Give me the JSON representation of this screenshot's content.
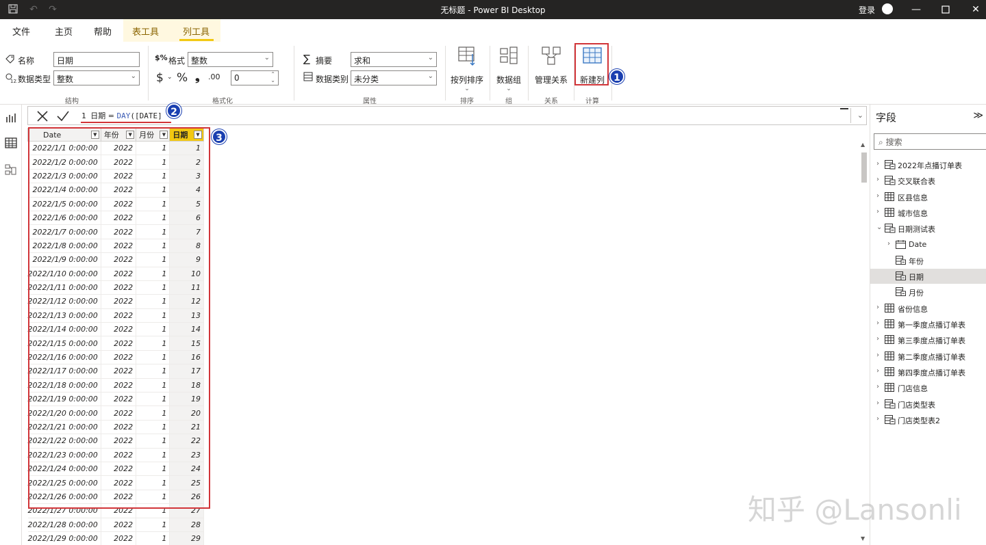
{
  "window": {
    "title": "无标题 - Power BI Desktop",
    "login": "登录"
  },
  "menu": {
    "tabs": [
      "文件",
      "主页",
      "帮助",
      "表工具",
      "列工具"
    ]
  },
  "ribbon": {
    "name_label": "名称",
    "name_value": "日期",
    "datatype_label": "数据类型",
    "datatype_value": "整数",
    "format_label": "格式",
    "format_value": "整数",
    "currency_symbol": "$",
    "percent_symbol": "%",
    "comma_symbol": "❟",
    "decimal_symbol": ".00",
    "decimals_value": "0",
    "summary_label": "摘要",
    "summary_value": "求和",
    "category_label": "数据类别",
    "category_value": "未分类",
    "sort_button": "按列排序",
    "datagroup_button": "数据组",
    "relations_button": "管理关系",
    "newcolumn_button": "新建列",
    "groups": [
      "结构",
      "格式化",
      "属性",
      "排序",
      "组",
      "关系",
      "计算"
    ]
  },
  "badges": [
    "1",
    "2",
    "3"
  ],
  "formula": {
    "line_number": "1",
    "text_prefix": "日期 = ",
    "function": "DAY",
    "argument": "([DATE]"
  },
  "table": {
    "columns": [
      "Date",
      "年份",
      "月份",
      "日期"
    ],
    "rows": [
      [
        "2022/1/1 0:00:00",
        "2022",
        "1",
        "1"
      ],
      [
        "2022/1/2 0:00:00",
        "2022",
        "1",
        "2"
      ],
      [
        "2022/1/3 0:00:00",
        "2022",
        "1",
        "3"
      ],
      [
        "2022/1/4 0:00:00",
        "2022",
        "1",
        "4"
      ],
      [
        "2022/1/5 0:00:00",
        "2022",
        "1",
        "5"
      ],
      [
        "2022/1/6 0:00:00",
        "2022",
        "1",
        "6"
      ],
      [
        "2022/1/7 0:00:00",
        "2022",
        "1",
        "7"
      ],
      [
        "2022/1/8 0:00:00",
        "2022",
        "1",
        "8"
      ],
      [
        "2022/1/9 0:00:00",
        "2022",
        "1",
        "9"
      ],
      [
        "2022/1/10 0:00:00",
        "2022",
        "1",
        "10"
      ],
      [
        "2022/1/11 0:00:00",
        "2022",
        "1",
        "11"
      ],
      [
        "2022/1/12 0:00:00",
        "2022",
        "1",
        "12"
      ],
      [
        "2022/1/13 0:00:00",
        "2022",
        "1",
        "13"
      ],
      [
        "2022/1/14 0:00:00",
        "2022",
        "1",
        "14"
      ],
      [
        "2022/1/15 0:00:00",
        "2022",
        "1",
        "15"
      ],
      [
        "2022/1/16 0:00:00",
        "2022",
        "1",
        "16"
      ],
      [
        "2022/1/17 0:00:00",
        "2022",
        "1",
        "17"
      ],
      [
        "2022/1/18 0:00:00",
        "2022",
        "1",
        "18"
      ],
      [
        "2022/1/19 0:00:00",
        "2022",
        "1",
        "19"
      ],
      [
        "2022/1/20 0:00:00",
        "2022",
        "1",
        "20"
      ],
      [
        "2022/1/21 0:00:00",
        "2022",
        "1",
        "21"
      ],
      [
        "2022/1/22 0:00:00",
        "2022",
        "1",
        "22"
      ],
      [
        "2022/1/23 0:00:00",
        "2022",
        "1",
        "23"
      ],
      [
        "2022/1/24 0:00:00",
        "2022",
        "1",
        "24"
      ],
      [
        "2022/1/25 0:00:00",
        "2022",
        "1",
        "25"
      ],
      [
        "2022/1/26 0:00:00",
        "2022",
        "1",
        "26"
      ],
      [
        "2022/1/27 0:00:00",
        "2022",
        "1",
        "27"
      ],
      [
        "2022/1/28 0:00:00",
        "2022",
        "1",
        "28"
      ],
      [
        "2022/1/29 0:00:00",
        "2022",
        "1",
        "29"
      ]
    ]
  },
  "fields": {
    "title": "字段",
    "search_placeholder": "搜索",
    "items": [
      {
        "label": "2022年点播订单表",
        "level": 0,
        "icon": "table-calc-icon",
        "chevron": "›"
      },
      {
        "label": "交叉联合表",
        "level": 0,
        "icon": "table-calc-icon",
        "chevron": "›"
      },
      {
        "label": "区县信息",
        "level": 0,
        "icon": "table-icon",
        "chevron": "›"
      },
      {
        "label": "城市信息",
        "level": 0,
        "icon": "table-icon",
        "chevron": "›"
      },
      {
        "label": "日期测试表",
        "level": 0,
        "icon": "table-calc-icon",
        "chevron": "⌄"
      },
      {
        "label": "Date",
        "level": 1,
        "icon": "calendar-icon",
        "chevron": "›"
      },
      {
        "label": "年份",
        "level": 1,
        "icon": "calc-column-icon",
        "chevron": ""
      },
      {
        "label": "日期",
        "level": 1,
        "icon": "calc-column-icon",
        "chevron": "",
        "selected": true
      },
      {
        "label": "月份",
        "level": 1,
        "icon": "calc-column-icon",
        "chevron": ""
      },
      {
        "label": "省份信息",
        "level": 0,
        "icon": "table-icon",
        "chevron": "›"
      },
      {
        "label": "第一季度点播订单表",
        "level": 0,
        "icon": "table-icon",
        "chevron": "›"
      },
      {
        "label": "第三季度点播订单表",
        "level": 0,
        "icon": "table-icon",
        "chevron": "›"
      },
      {
        "label": "第二季度点播订单表",
        "level": 0,
        "icon": "table-icon",
        "chevron": "›"
      },
      {
        "label": "第四季度点播订单表",
        "level": 0,
        "icon": "table-icon",
        "chevron": "›"
      },
      {
        "label": "门店信息",
        "level": 0,
        "icon": "table-icon",
        "chevron": "›"
      },
      {
        "label": "门店类型表",
        "level": 0,
        "icon": "table-calc-icon",
        "chevron": "›"
      },
      {
        "label": "门店类型表2",
        "level": 0,
        "icon": "table-calc-icon",
        "chevron": "›"
      }
    ]
  },
  "watermark": "知乎 @Lansonli",
  "colors": {
    "accent_yellow": "#f2c811",
    "highlight_red": "#d13438",
    "badge_blue": "#1a3fb0",
    "titlebar": "#252423"
  }
}
